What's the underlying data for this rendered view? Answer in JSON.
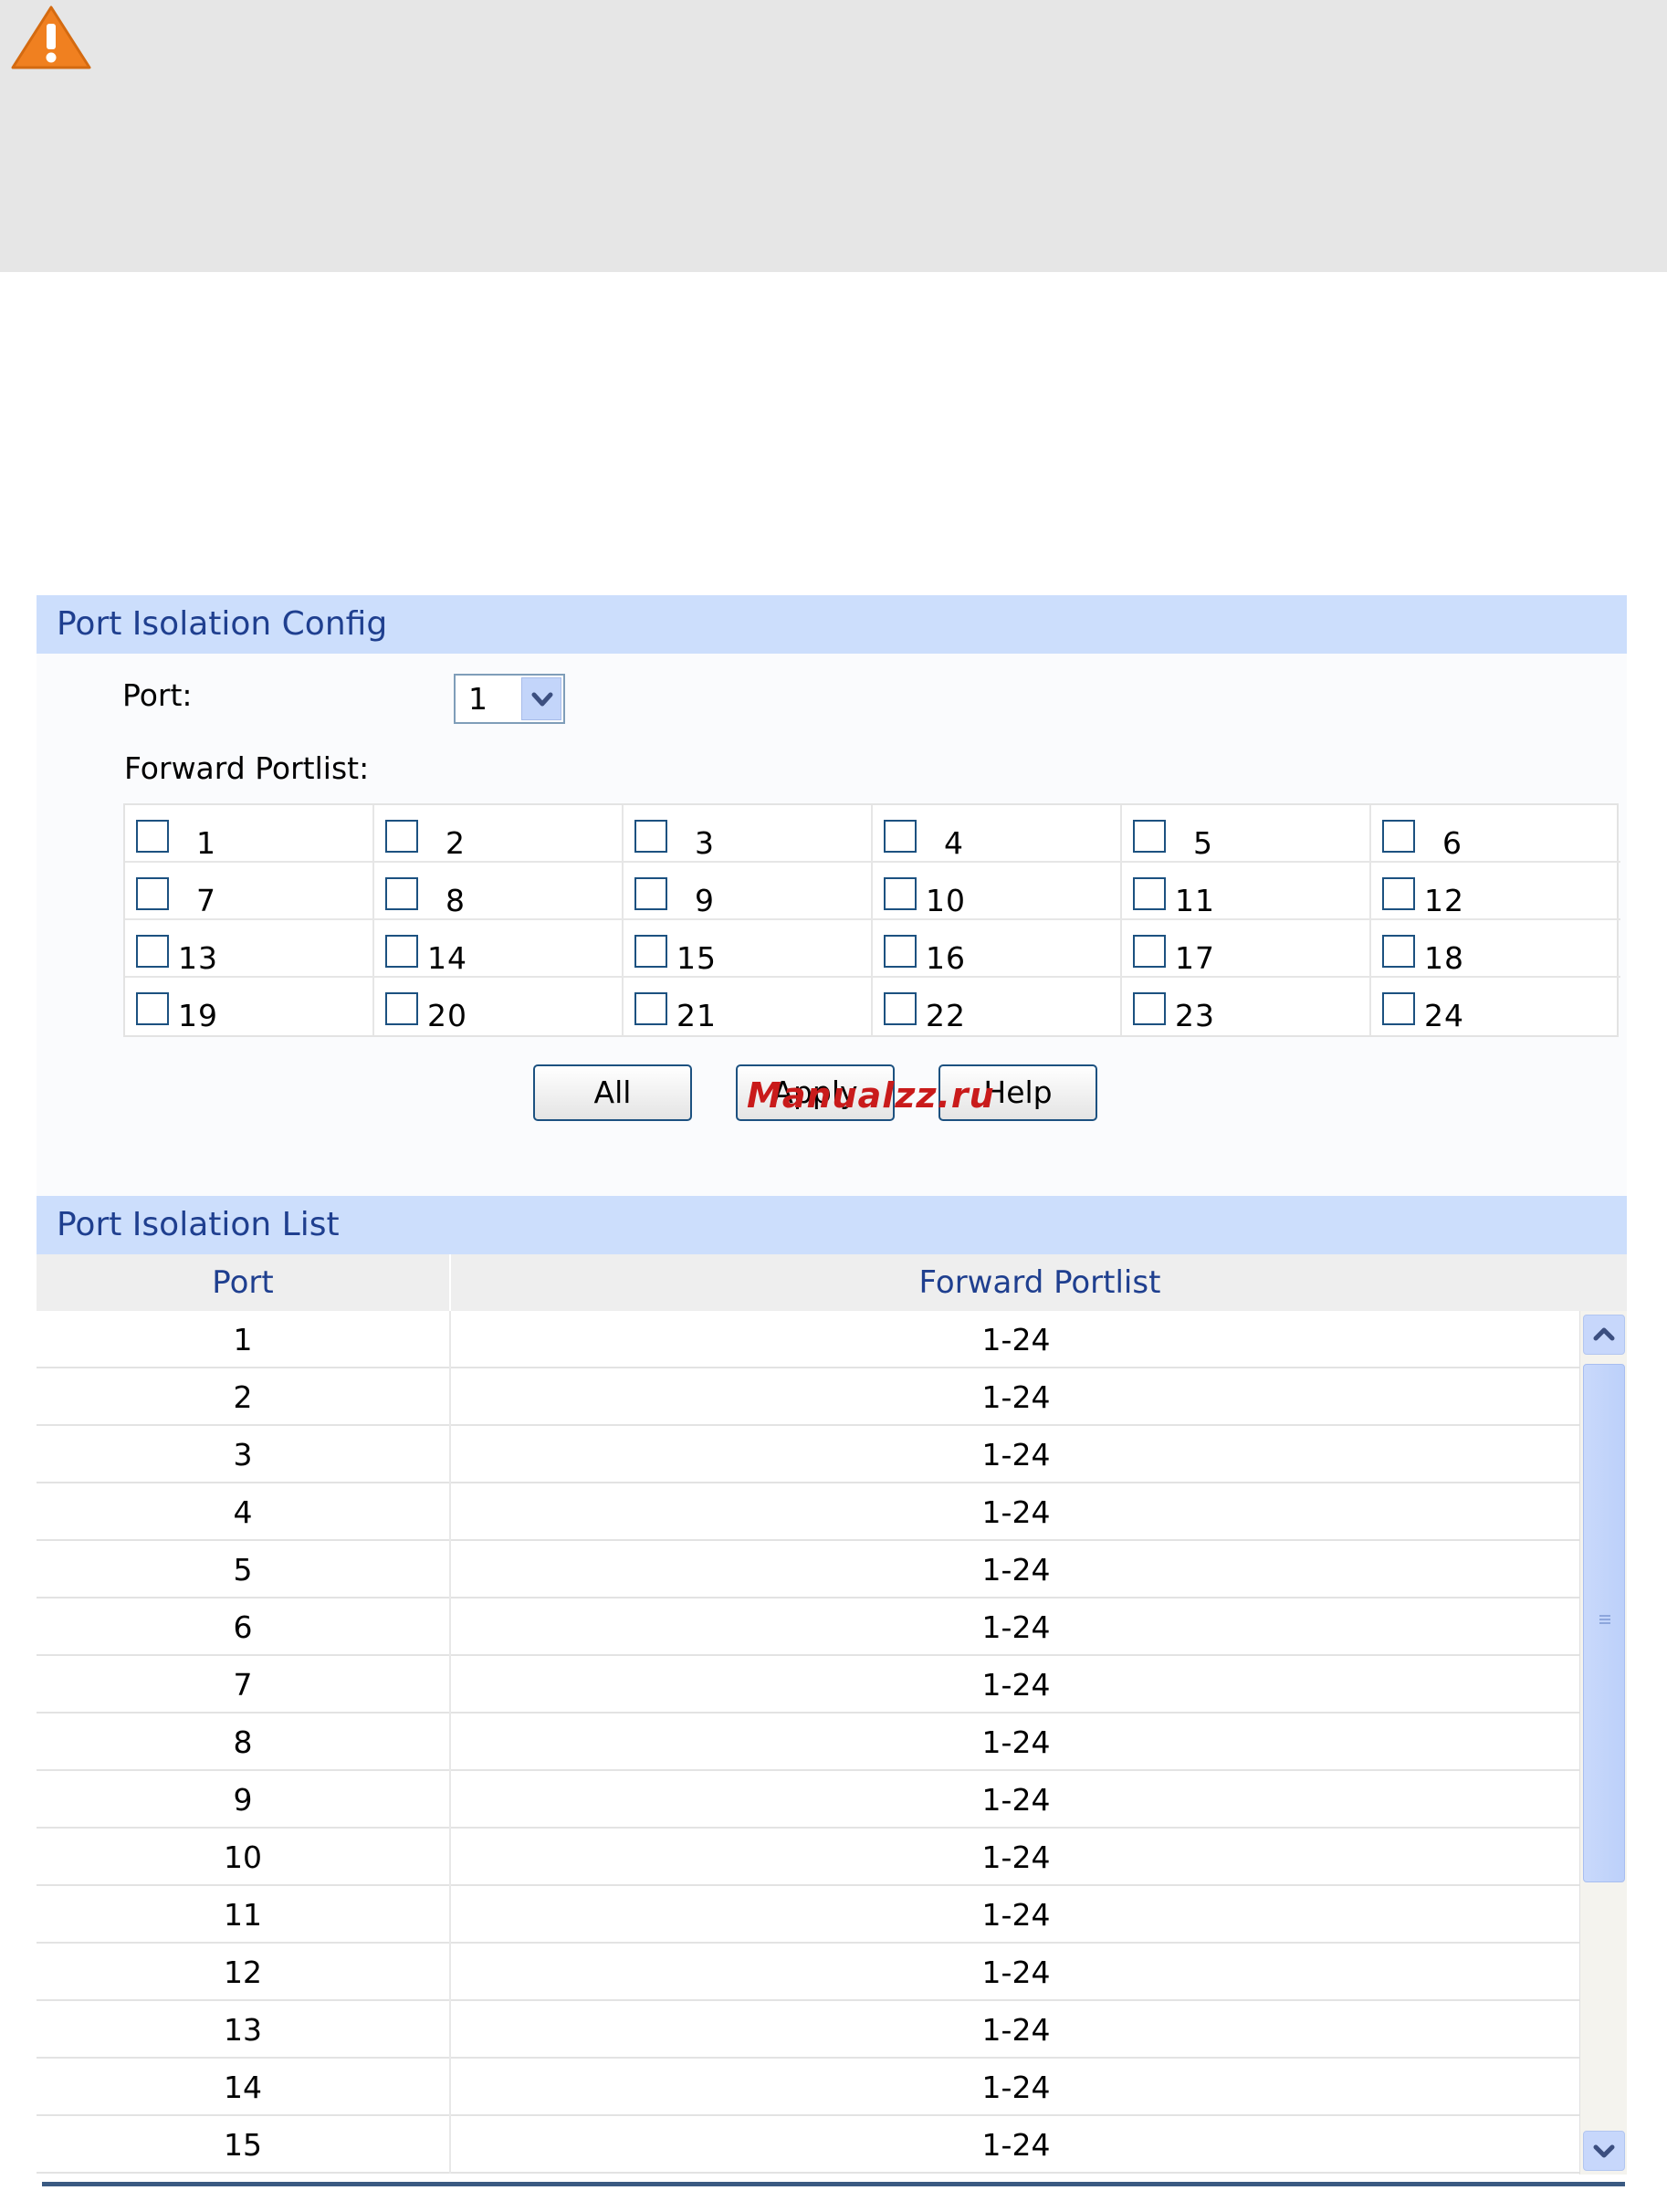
{
  "colors": {
    "header_bg": "#ccdefc",
    "header_text": "#1f3f8f",
    "note_bg": "#e6e6e6",
    "warning_orange": "#f08020",
    "watermark": "#c91b1b"
  },
  "config": {
    "title": "Port Isolation Config",
    "port_label": "Port:",
    "port_value": "1",
    "forward_label": "Forward Portlist:",
    "ports": [
      "1",
      "2",
      "3",
      "4",
      "5",
      "6",
      "7",
      "8",
      "9",
      "10",
      "11",
      "12",
      "13",
      "14",
      "15",
      "16",
      "17",
      "18",
      "19",
      "20",
      "21",
      "22",
      "23",
      "24"
    ],
    "buttons": {
      "all": "All",
      "apply": "Apply",
      "help": "Help"
    }
  },
  "watermark": "Manualzz.ru",
  "list": {
    "title": "Port Isolation List",
    "columns": [
      "Port",
      "Forward Portlist"
    ],
    "rows": [
      {
        "port": "1",
        "forward": "1-24"
      },
      {
        "port": "2",
        "forward": "1-24"
      },
      {
        "port": "3",
        "forward": "1-24"
      },
      {
        "port": "4",
        "forward": "1-24"
      },
      {
        "port": "5",
        "forward": "1-24"
      },
      {
        "port": "6",
        "forward": "1-24"
      },
      {
        "port": "7",
        "forward": "1-24"
      },
      {
        "port": "8",
        "forward": "1-24"
      },
      {
        "port": "9",
        "forward": "1-24"
      },
      {
        "port": "10",
        "forward": "1-24"
      },
      {
        "port": "11",
        "forward": "1-24"
      },
      {
        "port": "12",
        "forward": "1-24"
      },
      {
        "port": "13",
        "forward": "1-24"
      },
      {
        "port": "14",
        "forward": "1-24"
      },
      {
        "port": "15",
        "forward": "1-24"
      }
    ]
  }
}
